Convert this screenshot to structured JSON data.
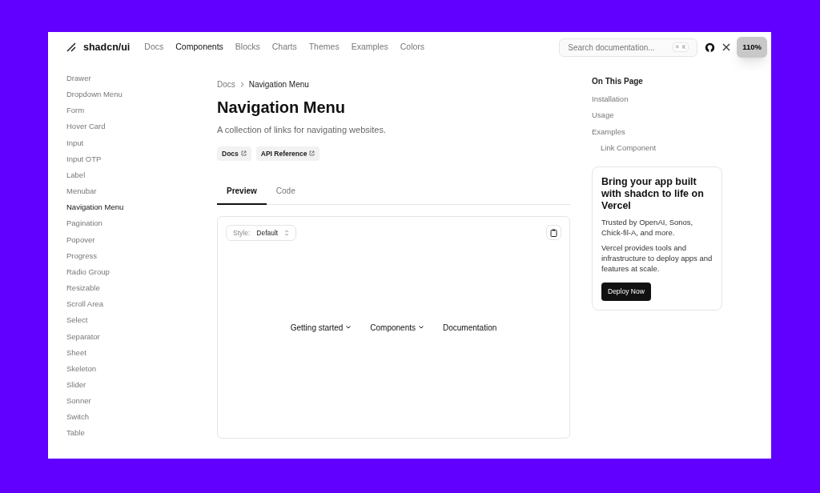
{
  "header": {
    "logo": "shadcn/ui",
    "nav": [
      {
        "label": "Docs",
        "selected": false
      },
      {
        "label": "Components",
        "selected": true
      },
      {
        "label": "Blocks",
        "selected": false
      },
      {
        "label": "Charts",
        "selected": false
      },
      {
        "label": "Themes",
        "selected": false
      },
      {
        "label": "Examples",
        "selected": false
      },
      {
        "label": "Colors",
        "selected": false
      }
    ],
    "search": {
      "placeholder": "Search documentation...",
      "shortcut": "⌘ K"
    },
    "zoom": "110%"
  },
  "sidebar": {
    "items": [
      {
        "label": "Drawer",
        "selected": false
      },
      {
        "label": "Dropdown Menu",
        "selected": false
      },
      {
        "label": "Form",
        "selected": false
      },
      {
        "label": "Hover Card",
        "selected": false
      },
      {
        "label": "Input",
        "selected": false
      },
      {
        "label": "Input OTP",
        "selected": false
      },
      {
        "label": "Label",
        "selected": false
      },
      {
        "label": "Menubar",
        "selected": false
      },
      {
        "label": "Navigation Menu",
        "selected": true
      },
      {
        "label": "Pagination",
        "selected": false
      },
      {
        "label": "Popover",
        "selected": false
      },
      {
        "label": "Progress",
        "selected": false
      },
      {
        "label": "Radio Group",
        "selected": false
      },
      {
        "label": "Resizable",
        "selected": false
      },
      {
        "label": "Scroll Area",
        "selected": false
      },
      {
        "label": "Select",
        "selected": false
      },
      {
        "label": "Separator",
        "selected": false
      },
      {
        "label": "Sheet",
        "selected": false
      },
      {
        "label": "Skeleton",
        "selected": false
      },
      {
        "label": "Slider",
        "selected": false
      },
      {
        "label": "Sonner",
        "selected": false
      },
      {
        "label": "Switch",
        "selected": false
      },
      {
        "label": "Table",
        "selected": false
      }
    ]
  },
  "main": {
    "breadcrumb": [
      "Docs",
      "Navigation Menu"
    ],
    "title": "Navigation Menu",
    "description": "A collection of links for navigating websites.",
    "links": [
      "Docs",
      "API Reference"
    ],
    "tabs": [
      {
        "label": "Preview",
        "selected": true
      },
      {
        "label": "Code",
        "selected": false
      }
    ],
    "preview": {
      "style_label": "Style:",
      "style_value": "Default",
      "menu": [
        {
          "label": "Getting started",
          "has_caret": true
        },
        {
          "label": "Components",
          "has_caret": true
        },
        {
          "label": "Documentation",
          "has_caret": false
        }
      ]
    }
  },
  "toc": {
    "title": "On This Page",
    "items": [
      {
        "label": "Installation"
      },
      {
        "label": "Usage"
      },
      {
        "label": "Examples",
        "children": [
          {
            "label": "Link Component"
          }
        ]
      }
    ]
  },
  "promo": {
    "title": "Bring your app built with shadcn to life on Vercel",
    "text1": "Trusted by OpenAI, Sonos, Chick-fil-A, and more.",
    "text2": "Vercel provides tools and infrastructure to deploy apps and features at scale.",
    "button": "Deploy Now"
  }
}
